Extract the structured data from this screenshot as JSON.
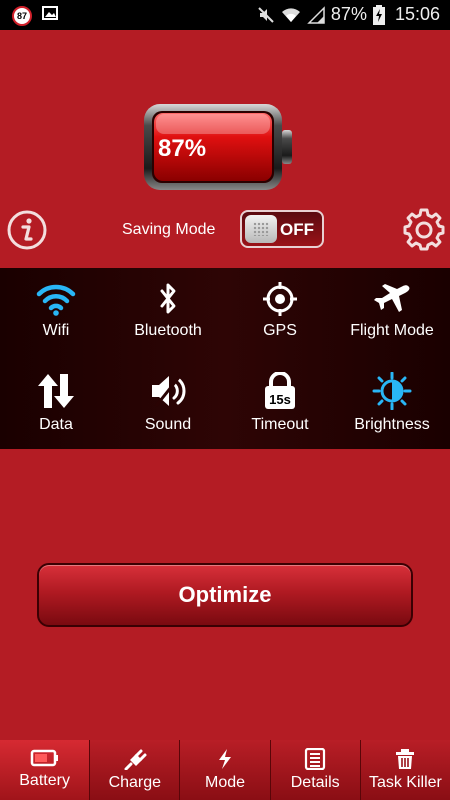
{
  "status_bar": {
    "badge": "87",
    "battery_percent": "87%",
    "time": "15:06"
  },
  "battery": {
    "percent_label": "87%",
    "level": 0.87
  },
  "saving_mode": {
    "label": "Saving Mode",
    "state": "OFF"
  },
  "toggles": [
    {
      "label": "Wifi",
      "icon": "wifi-icon"
    },
    {
      "label": "Bluetooth",
      "icon": "bluetooth-icon"
    },
    {
      "label": "GPS",
      "icon": "gps-icon"
    },
    {
      "label": "Flight Mode",
      "icon": "airplane-icon"
    },
    {
      "label": "Data",
      "icon": "data-arrows-icon"
    },
    {
      "label": "Sound",
      "icon": "sound-icon"
    },
    {
      "label": "Timeout",
      "icon": "timeout-lock-icon",
      "icon_text": "15s"
    },
    {
      "label": "Brightness",
      "icon": "brightness-icon"
    }
  ],
  "optimize": {
    "label": "Optimize"
  },
  "bottom_nav": [
    {
      "label": "Battery",
      "icon": "battery-icon",
      "active": true
    },
    {
      "label": "Charge",
      "icon": "plug-icon",
      "active": false
    },
    {
      "label": "Mode",
      "icon": "bolt-icon",
      "active": false
    },
    {
      "label": "Details",
      "icon": "list-icon",
      "active": false
    },
    {
      "label": "Task Killer",
      "icon": "trash-icon",
      "active": false
    }
  ],
  "colors": {
    "background": "#b41c24",
    "accent_blue": "#29b6f6",
    "panel": "#1f0202"
  }
}
